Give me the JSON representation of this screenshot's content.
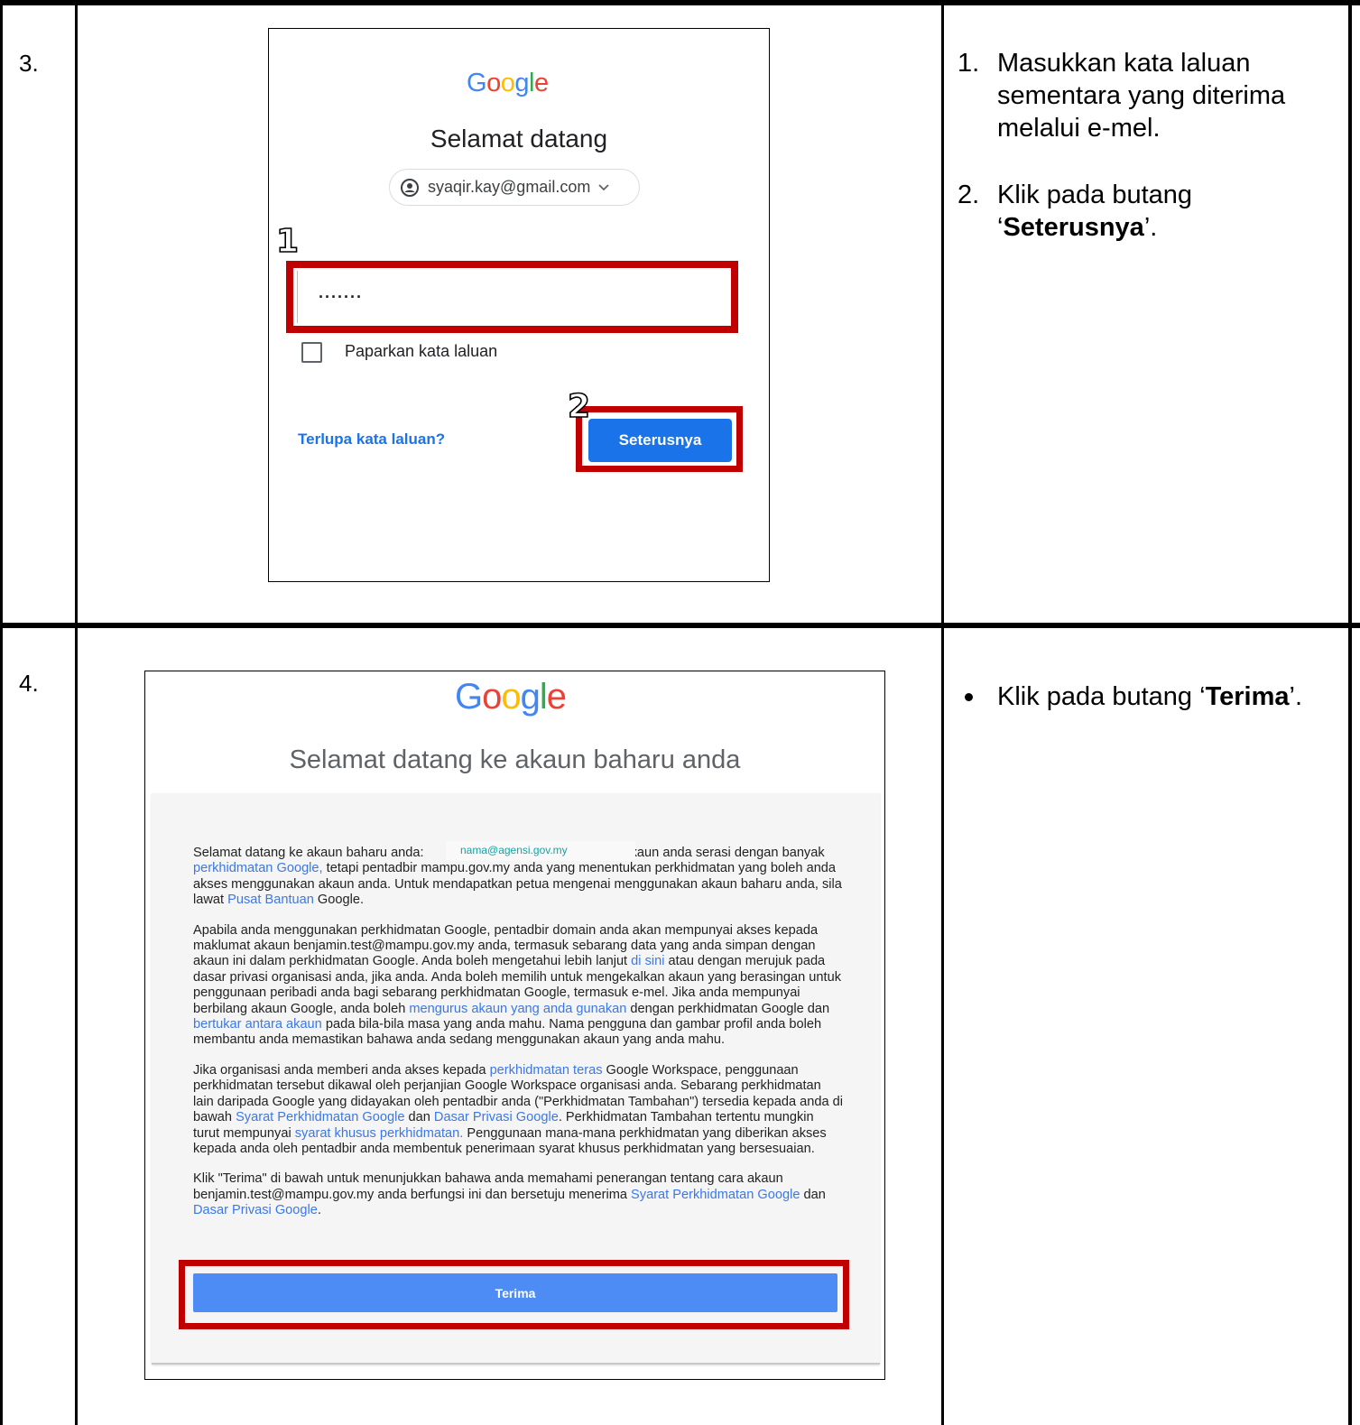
{
  "rows": [
    {
      "number": "3.",
      "screenshot": {
        "logo": [
          "G",
          "o",
          "o",
          "g",
          "l",
          "e"
        ],
        "heading": "Selamat datang",
        "account_email": "syaqir.kay@gmail.com",
        "callout_1": "1",
        "password_value": "·······",
        "show_password_label": "Paparkan kata laluan",
        "callout_2": "2",
        "forgot_link": "Terlupa kata laluan?",
        "next_button": "Seterusnya"
      },
      "instructions": [
        {
          "marker": "1.",
          "text": "Masukkan kata laluan sementara yang diterima melalui e-mel."
        },
        {
          "marker": "2.",
          "pre": "Klik pada butang ‘",
          "bold": "Seterusnya",
          "post": "’."
        }
      ]
    },
    {
      "number": "4.",
      "screenshot": {
        "logo": [
          "G",
          "o",
          "o",
          "g",
          "l",
          "e"
        ],
        "heading": "Selamat datang ke akaun baharu anda",
        "email_overlay": "nama@agensi.gov.my",
        "p1": {
          "a": "Selamat datang ke akaun baharu anda: ",
          "b": " Akaun anda serasi dengan banyak ",
          "l1": "perkhidmatan Google,",
          "c": " tetapi pentadbir mampu.gov.my anda yang menentukan perkhidmatan yang boleh anda akses menggunakan akaun anda. Untuk mendapatkan petua mengenai menggunakan akaun baharu anda, sila lawat ",
          "l2": "Pusat Bantuan",
          "d": " Google."
        },
        "p2": {
          "a": "Apabila anda menggunakan perkhidmatan Google, pentadbir domain anda akan mempunyai akses kepada maklumat akaun benjamin.test@mampu.gov.my anda, termasuk sebarang data yang anda simpan dengan akaun ini dalam perkhidmatan Google. Anda boleh mengetahui lebih lanjut ",
          "l1": "di sini",
          "b": " atau dengan merujuk pada dasar privasi organisasi anda, jika anda. Anda boleh memilih untuk mengekalkan akaun yang berasingan untuk penggunaan peribadi anda bagi sebarang perkhidmatan Google, termasuk e-mel. Jika anda mempunyai berbilang akaun Google, anda boleh ",
          "l2": "mengurus akaun yang anda gunakan",
          "c": " dengan perkhidmatan Google dan ",
          "l3": "bertukar antara akaun",
          "d": " pada bila-bila masa yang anda mahu. Nama pengguna dan gambar profil anda boleh membantu anda memastikan bahawa anda sedang menggunakan akaun yang anda mahu."
        },
        "p3": {
          "a": "Jika organisasi anda memberi anda akses kepada ",
          "l1": "perkhidmatan teras",
          "b": " Google Workspace, penggunaan perkhidmatan tersebut dikawal oleh perjanjian Google Workspace organisasi anda. Sebarang perkhidmatan lain daripada Google yang didayakan oleh pentadbir anda (\"Perkhidmatan Tambahan\") tersedia kepada anda di bawah ",
          "l2": "Syarat Perkhidmatan Google",
          "c": " dan ",
          "l3": "Dasar Privasi Google",
          "d": ". Perkhidmatan Tambahan tertentu mungkin turut mempunyai ",
          "l4": "syarat khusus perkhidmatan.",
          "e": " Penggunaan mana-mana perkhidmatan yang diberikan akses kepada anda oleh pentadbir anda membentuk penerimaan syarat khusus perkhidmatan yang bersesuaian."
        },
        "p4": {
          "a": "Klik \"Terima\" di bawah untuk menunjukkan bahawa anda memahami penerangan tentang cara akaun benjamin.test@mampu.gov.my anda berfungsi ini dan bersetuju menerima ",
          "l1": "Syarat Perkhidmatan Google",
          "b": " dan ",
          "l2": "Dasar Privasi Google",
          "c": "."
        },
        "accept_button": "Terima"
      },
      "instructions": [
        {
          "marker": "bullet",
          "pre": "Klik pada butang ‘",
          "bold": "Terima",
          "post": "’."
        }
      ]
    }
  ],
  "colors": {
    "highlight": "#c00000",
    "google_blue": "#4285f4",
    "google_red": "#ea4335",
    "google_yellow": "#fbbc05",
    "google_green": "#34a853",
    "button_blue": "#1a73e8",
    "link_blue": "#3b78e7"
  },
  "icons": [
    "account-circle-icon",
    "chevron-down-icon",
    "checkbox-icon",
    "bullet-icon"
  ]
}
